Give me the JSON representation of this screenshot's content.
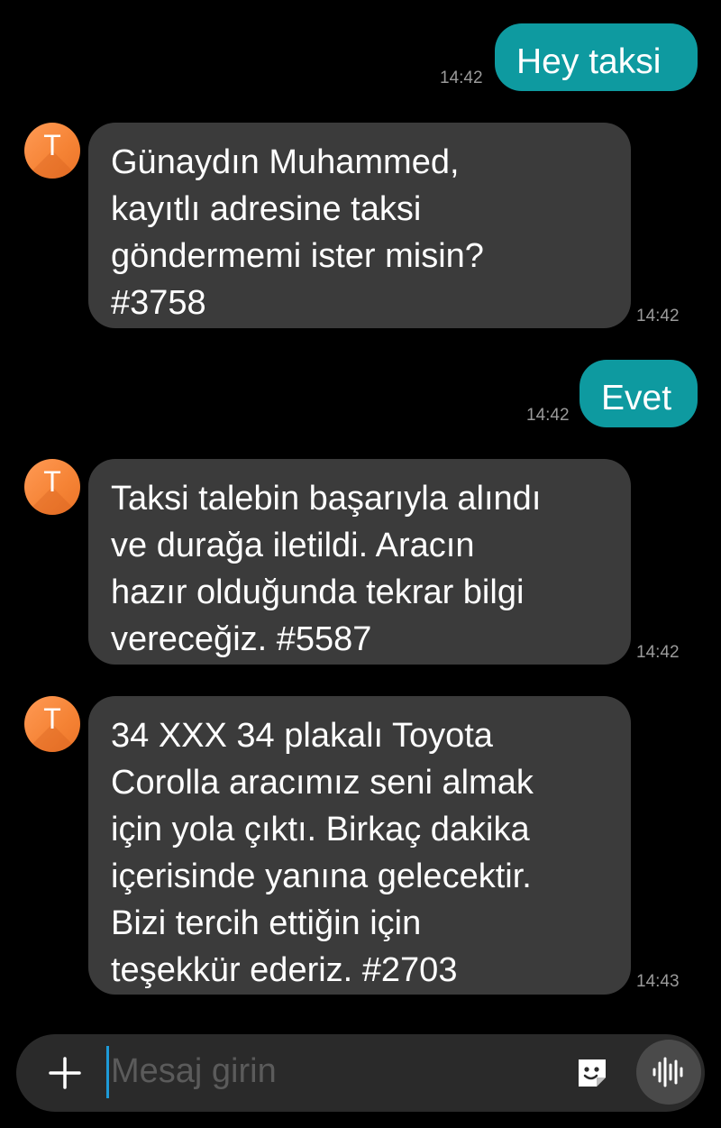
{
  "messages": [
    {
      "direction": "out",
      "text": "Hey taksi",
      "time": "14:42"
    },
    {
      "direction": "in",
      "avatar_letter": "T",
      "lines": [
        "Günaydın Muhammed,",
        "kayıtlı adresine taksi",
        "göndermemi ister misin?",
        "#3758"
      ],
      "time": "14:42"
    },
    {
      "direction": "out",
      "text": "Evet",
      "time": "14:42"
    },
    {
      "direction": "in",
      "avatar_letter": "T",
      "lines": [
        "Taksi talebin başarıyla alındı",
        "ve durağa iletildi. Aracın",
        "hazır olduğunda tekrar bilgi",
        "vereceğiz. #5587"
      ],
      "time": "14:42"
    },
    {
      "direction": "in",
      "avatar_letter": "T",
      "lines": [
        "34 XXX 34 plakalı Toyota",
        "Corolla aracımız seni almak",
        "için yola çıktı. Birkaç dakika",
        "içerisinde yanına gelecektir.",
        "Bizi tercih ettiğin için",
        "teşekkür ederiz. #2703"
      ],
      "time": "14:43"
    }
  ],
  "composer": {
    "placeholder": "Mesaj girin",
    "add_icon": "plus-icon",
    "sticker_icon": "sticker-icon",
    "voice_icon": "voice-waveform-icon"
  },
  "colors": {
    "outgoing_bubble": "#0e9aa0",
    "incoming_bubble": "#3b3b3b",
    "avatar": "#f58335",
    "background": "#000000"
  }
}
